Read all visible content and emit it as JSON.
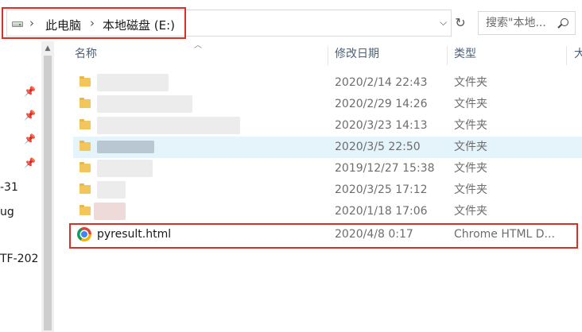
{
  "address": {
    "crumbs": [
      "此电脑",
      "本地磁盘 (E:)"
    ],
    "separator": "›",
    "dropdown": "⌵",
    "refresh": "↻"
  },
  "search": {
    "placeholder": "搜索\"本地..."
  },
  "columns": {
    "name": "名称",
    "date": "修改日期",
    "type": "类型",
    "size": "大"
  },
  "nav": {
    "items": [
      "-31",
      "ug",
      "TF-202"
    ]
  },
  "files": [
    {
      "name": "",
      "date": "2020/2/14 22:43",
      "type": "文件夹"
    },
    {
      "name": "",
      "date": "2020/2/29 14:26",
      "type": "文件夹"
    },
    {
      "name": "",
      "date": "2020/3/23 14:13",
      "type": "文件夹"
    },
    {
      "name": "",
      "date": "2020/3/5 22:50",
      "type": "文件夹"
    },
    {
      "name": "",
      "date": "2019/12/27 15:38",
      "type": "文件夹"
    },
    {
      "name": "",
      "date": "2020/3/25 17:12",
      "type": "文件夹"
    },
    {
      "name": "",
      "date": "2020/1/18 17:06",
      "type": "文件夹"
    },
    {
      "name": "pyresult.html",
      "date": "2020/4/8 0:17",
      "type": "Chrome HTML D..."
    }
  ],
  "icons": {
    "drive": "drive-icon",
    "folder": "folder-icon",
    "chrome": "chrome-icon",
    "pin": "pin-icon",
    "search": "search-icon"
  },
  "colors": {
    "highlight": "#d93025",
    "selected_row": "#e5f3fb",
    "header_text": "#4c607a",
    "folder": "#f2c65a"
  }
}
